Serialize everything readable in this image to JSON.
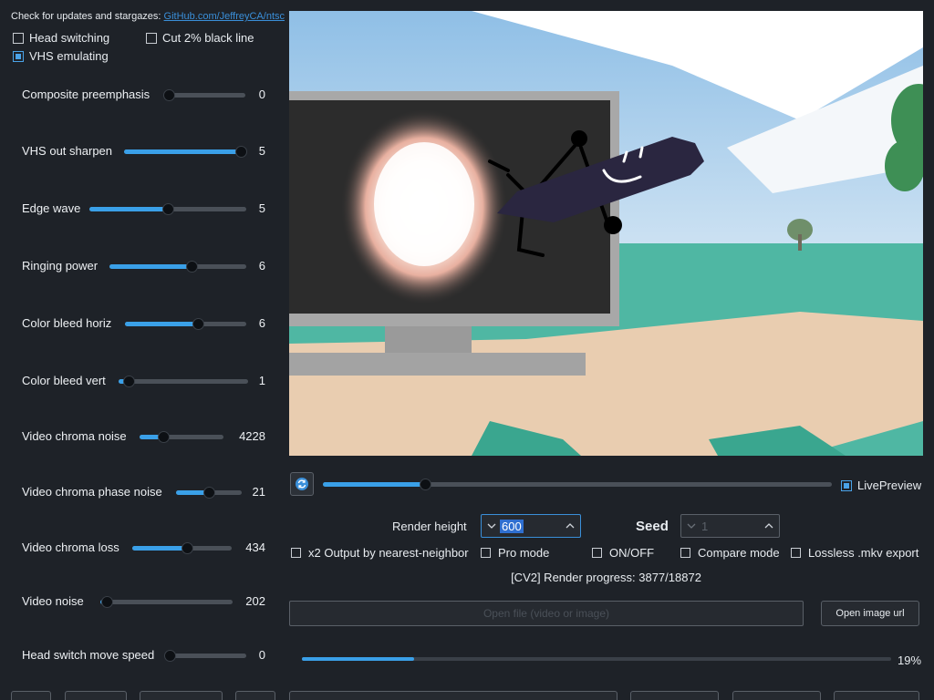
{
  "header": {
    "update_text": "Check for updates and stargazes:",
    "update_link": "GitHub.com/JeffreyCA/ntsc"
  },
  "options": {
    "head_switching": {
      "label": "Head switching",
      "checked": false
    },
    "cut_black_line": {
      "label": "Cut 2% black line",
      "checked": false
    },
    "vhs_emulating": {
      "label": "VHS emulating",
      "checked": true
    }
  },
  "sliders": [
    {
      "label": "Composite preemphasis",
      "value": "0",
      "fraction": 0.0
    },
    {
      "label": "VHS out sharpen",
      "value": "5",
      "fraction": 1.0
    },
    {
      "label": "Edge wave",
      "value": "5",
      "fraction": 0.5
    },
    {
      "label": "Ringing power",
      "value": "6",
      "fraction": 0.6
    },
    {
      "label": "Color bleed horiz",
      "value": "6",
      "fraction": 0.6
    },
    {
      "label": "Color bleed vert",
      "value": "1",
      "fraction": 0.08
    },
    {
      "label": "Video chroma noise",
      "value": "4228",
      "fraction": 0.28
    },
    {
      "label": "Video chroma phase noise",
      "value": "21",
      "fraction": 0.5
    },
    {
      "label": "Video chroma loss",
      "value": "434",
      "fraction": 0.55
    },
    {
      "label": "Video noise",
      "value": "202",
      "fraction": 0.05
    },
    {
      "label": "Head switch move speed",
      "value": "0",
      "fraction": 0.0
    }
  ],
  "timeline": {
    "fraction": 0.2,
    "live_preview_label": "LivePreview",
    "live_preview_checked": true
  },
  "render_height": {
    "label": "Render height",
    "value": "600"
  },
  "seed": {
    "label": "Seed",
    "value": "1"
  },
  "checkboxes2": [
    {
      "label": "x2 Output by nearest-neighbor",
      "checked": false
    },
    {
      "label": "Pro mode",
      "checked": false
    },
    {
      "label": "ON/OFF",
      "checked": false
    },
    {
      "label": "Compare mode",
      "checked": false
    },
    {
      "label": "Lossless .mkv export",
      "checked": false
    }
  ],
  "render_progress": "[CV2] Render progress: 3877/18872",
  "open_file": {
    "placeholder": "Open file (video or image)",
    "button": "Open image url"
  },
  "progress": {
    "fraction": 0.19,
    "label": "19%"
  },
  "colors": {
    "accent": "#3aa0e8",
    "background": "#1e2228"
  }
}
